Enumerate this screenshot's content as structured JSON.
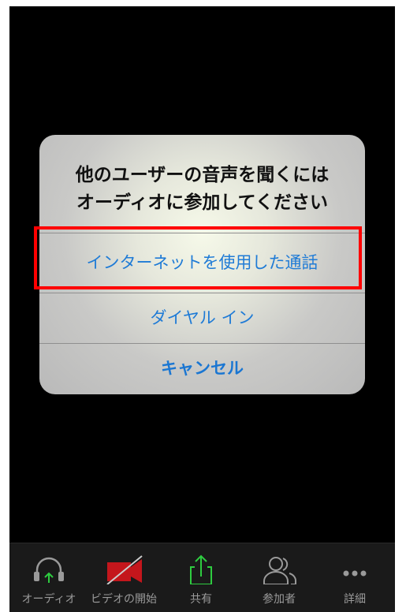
{
  "dialog": {
    "title_line1": "他のユーザーの音声を聞くには",
    "title_line2": "オーディオに参加してください",
    "options": [
      {
        "label": "インターネットを使用した通話"
      },
      {
        "label": "ダイヤル イン"
      },
      {
        "label": "キャンセル"
      }
    ]
  },
  "toolbar": {
    "items": [
      {
        "label": "オーディオ",
        "icon": "headphones-icon"
      },
      {
        "label": "ビデオの開始",
        "icon": "video-off-icon"
      },
      {
        "label": "共有",
        "icon": "share-icon"
      },
      {
        "label": "参加者",
        "icon": "participants-icon"
      },
      {
        "label": "詳細",
        "icon": "more-icon"
      }
    ]
  },
  "colors": {
    "accent": "#1f7bd6",
    "highlight": "#ff0000",
    "video_off": "#c4161c",
    "share": "#2ecc40",
    "audio_arrow": "#2ecc40"
  }
}
